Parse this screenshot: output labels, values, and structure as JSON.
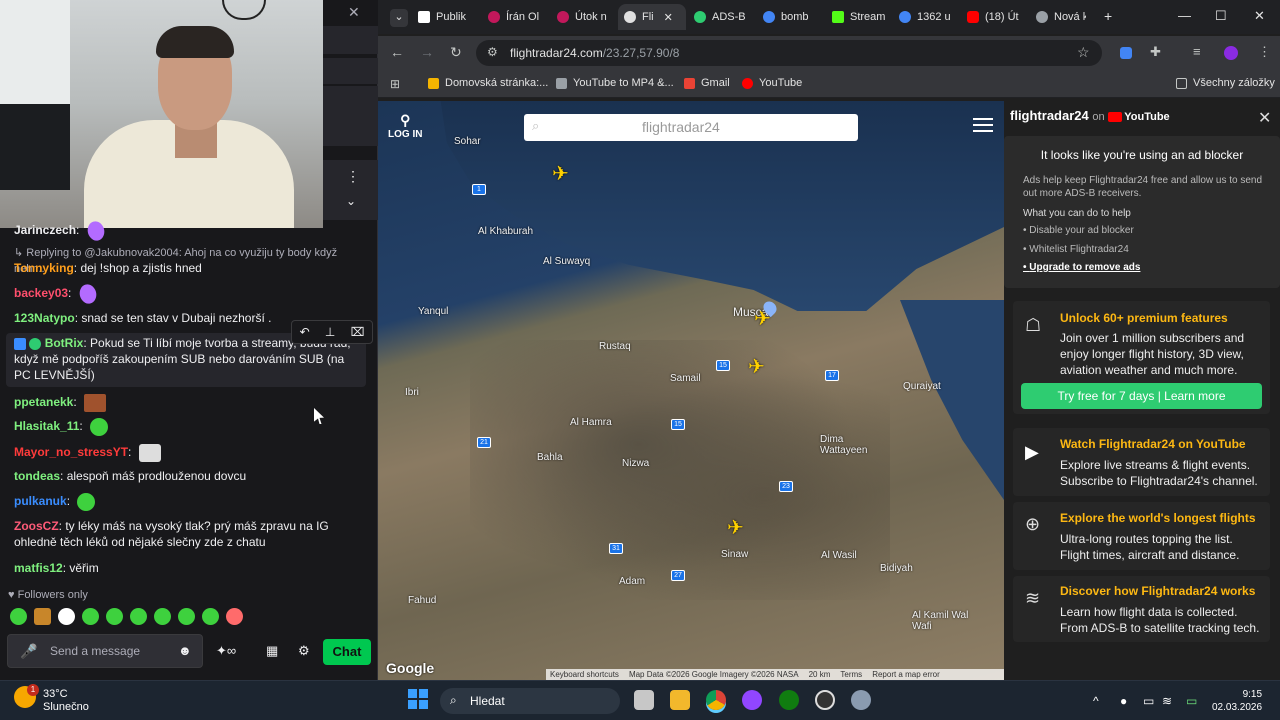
{
  "chat": {
    "close_icon": "✕",
    "more_icon": "⋮",
    "chevron_icon": "⌄",
    "messages": [
      {
        "user": "Jarinczech",
        "color": "#efeff1",
        "text": ""
      },
      {
        "reply": "↳ Replying to @Jakubnovak2004: Ahoj na co využiju ty body když nehr..."
      },
      {
        "user": "Tonnyking",
        "color": "#ff9f1c",
        "text": "dej !shop a zjistis hned"
      },
      {
        "user": "backey03",
        "color": "#ff4f6d",
        "text": ""
      },
      {
        "user": "123Natypo",
        "color": "#7ff07f",
        "text": "snad se ten stav v Dubaji nezhorší ."
      },
      {
        "user": "BotRix",
        "color": "#7ff07f",
        "text": "Pokud se Ti líbí moje tvorba a streamy, budu rád, když mě podpoříš zakoupením SUB nebo darováním SUB (na PC LEVNĚJŠÍ)"
      },
      {
        "user": "ppetanekk",
        "color": "#7ff07f",
        "text": ""
      },
      {
        "user": "Hlasitak_11",
        "color": "#7ff07f",
        "text": ""
      },
      {
        "user": "Mayor_no_stressYT",
        "color": "#ff3b3b",
        "text": ""
      },
      {
        "user": "tondeas",
        "color": "#7ff07f",
        "text": "alespoň máš prodlouženou dovcu"
      },
      {
        "user": "pulkanuk",
        "color": "#3a8dff",
        "text": ""
      },
      {
        "user": "ZoosCZ",
        "color": "#ff5b78",
        "text": "ty léky máš na vysoký tlak? prý máš zpravu na IG ohledně těch léků od nějaké slečny zde z chatu"
      },
      {
        "user": "matfis12",
        "color": "#7ff07f",
        "text": "věřim"
      }
    ],
    "followers_only": "Followers only",
    "input_placeholder": "Send a message",
    "chat_button": "Chat",
    "icons": {
      "mic": "🎤",
      "smiley": "☻",
      "bits": "✦∞",
      "store": "▦",
      "settings": "⚙",
      "heart": "♥"
    }
  },
  "browser": {
    "tabs": [
      {
        "label": "Publik",
        "fav": "#ffffff",
        "active": false
      },
      {
        "label": "Írán Ol",
        "fav": "#c2185b",
        "active": false
      },
      {
        "label": "Útok n",
        "fav": "#c2185b",
        "active": false
      },
      {
        "label": "Fli",
        "fav": "#e0e0e0",
        "active": true
      },
      {
        "label": "ADS-B",
        "fav": "#2ecc71",
        "active": false
      },
      {
        "label": "bomb",
        "fav": "#4285f4",
        "active": false
      },
      {
        "label": "Stream",
        "fav": "#53fc18",
        "active": false
      },
      {
        "label": "1362 u",
        "fav": "#4285f4",
        "active": false
      },
      {
        "label": "(18) Út",
        "fav": "#ff0000",
        "active": false
      },
      {
        "label": "Nová k",
        "fav": "#9aa0a6",
        "active": false
      }
    ],
    "tab_close_icon": "✕",
    "new_tab_icon": "+",
    "tab_search_icon": "⌄",
    "window_controls": {
      "minimize": "—",
      "maximize": "☐",
      "close": "✕"
    },
    "url_host": "flightradar24.com",
    "url_path": "/23.27,57.90/8",
    "bookmarks": [
      {
        "label": "Domovská stránka:...",
        "fav": "#f4b400"
      },
      {
        "label": "YouTube to MP4 &...",
        "fav": "#9aa0a6"
      },
      {
        "label": "Gmail",
        "fav": "#ea4335"
      },
      {
        "label": "YouTube",
        "fav": "#ff0000"
      }
    ],
    "all_bookmarks": "Všechny záložky"
  },
  "map": {
    "login": "LOG IN",
    "search_logo": "flightradar24",
    "places": [
      {
        "name": "Sohar",
        "cls": "p1"
      },
      {
        "name": "Al Khaburah",
        "cls": "p2"
      },
      {
        "name": "Al Suwayq",
        "cls": "p3"
      },
      {
        "name": "Yanqul",
        "cls": "p4"
      },
      {
        "name": "Rustaq",
        "cls": "p5"
      },
      {
        "name": "Muscat",
        "cls": "p6"
      },
      {
        "name": "Samail",
        "cls": "p7"
      },
      {
        "name": "Ibri",
        "cls": "p8"
      },
      {
        "name": "Al Hamra",
        "cls": "p9"
      },
      {
        "name": "Bahla",
        "cls": "p10"
      },
      {
        "name": "Nizwa",
        "cls": "p11"
      },
      {
        "name": "Dima Wattayeen",
        "cls": "p12"
      },
      {
        "name": "Quraiyat",
        "cls": "p13"
      },
      {
        "name": "Sinaw",
        "cls": "p14"
      },
      {
        "name": "Adam",
        "cls": "p15"
      },
      {
        "name": "Al Wasil",
        "cls": "p16"
      },
      {
        "name": "Bidiyah",
        "cls": "p17"
      },
      {
        "name": "Fahud",
        "cls": "p18"
      },
      {
        "name": "Al Kamil Wal Wafi",
        "cls": "p19"
      }
    ],
    "roads": [
      "1",
      "15",
      "17",
      "15",
      "21",
      "23",
      "27",
      "31"
    ],
    "google": "Google",
    "attribution": [
      "Keyboard shortcuts",
      "Map Data ©2026 Google Imagery ©2026 NASA",
      "20 km",
      "Terms",
      "Report a map error"
    ]
  },
  "side": {
    "brand": "flightradar24",
    "on": "on",
    "youtube": "YouTube",
    "close_icon": "✕",
    "adblock_title": "It looks like you're using an ad blocker",
    "adblock_text": "Ads help keep Flightradar24 free and allow us to send out more ADS-B receivers.",
    "adblock_subtitle": "What you can do to help",
    "adblock_items": [
      "Disable your ad blocker",
      "Whitelist Flightradar24",
      "Upgrade to remove ads"
    ],
    "cards": [
      {
        "title": "Unlock 60+ premium features",
        "text": "Join over 1 million subscribers and enjoy longer flight history, 3D view, aviation weather and much more.",
        "icon": "☖"
      },
      {
        "title": "Watch Flightradar24 on YouTube",
        "text": "Explore live streams & flight events. Subscribe to Flightradar24's channel.",
        "icon": "▶"
      },
      {
        "title": "Explore the world's longest flights",
        "text": "Ultra-long routes topping the list. Flight times, aircraft and distance.",
        "icon": "⊕"
      },
      {
        "title": "Discover how Flightradar24 works",
        "text": "Learn how flight data is collected. From ADS-B to satellite tracking tech.",
        "icon": "≋"
      }
    ],
    "try_button": "Try free for 7 days | Learn more"
  },
  "taskbar": {
    "badge": "1",
    "temp": "33°C",
    "weather": "Slunečno",
    "search": "Hledat",
    "time": "9:15",
    "date": "02.03.2026",
    "icons": {
      "search": "⌕",
      "chevron": "^"
    }
  }
}
